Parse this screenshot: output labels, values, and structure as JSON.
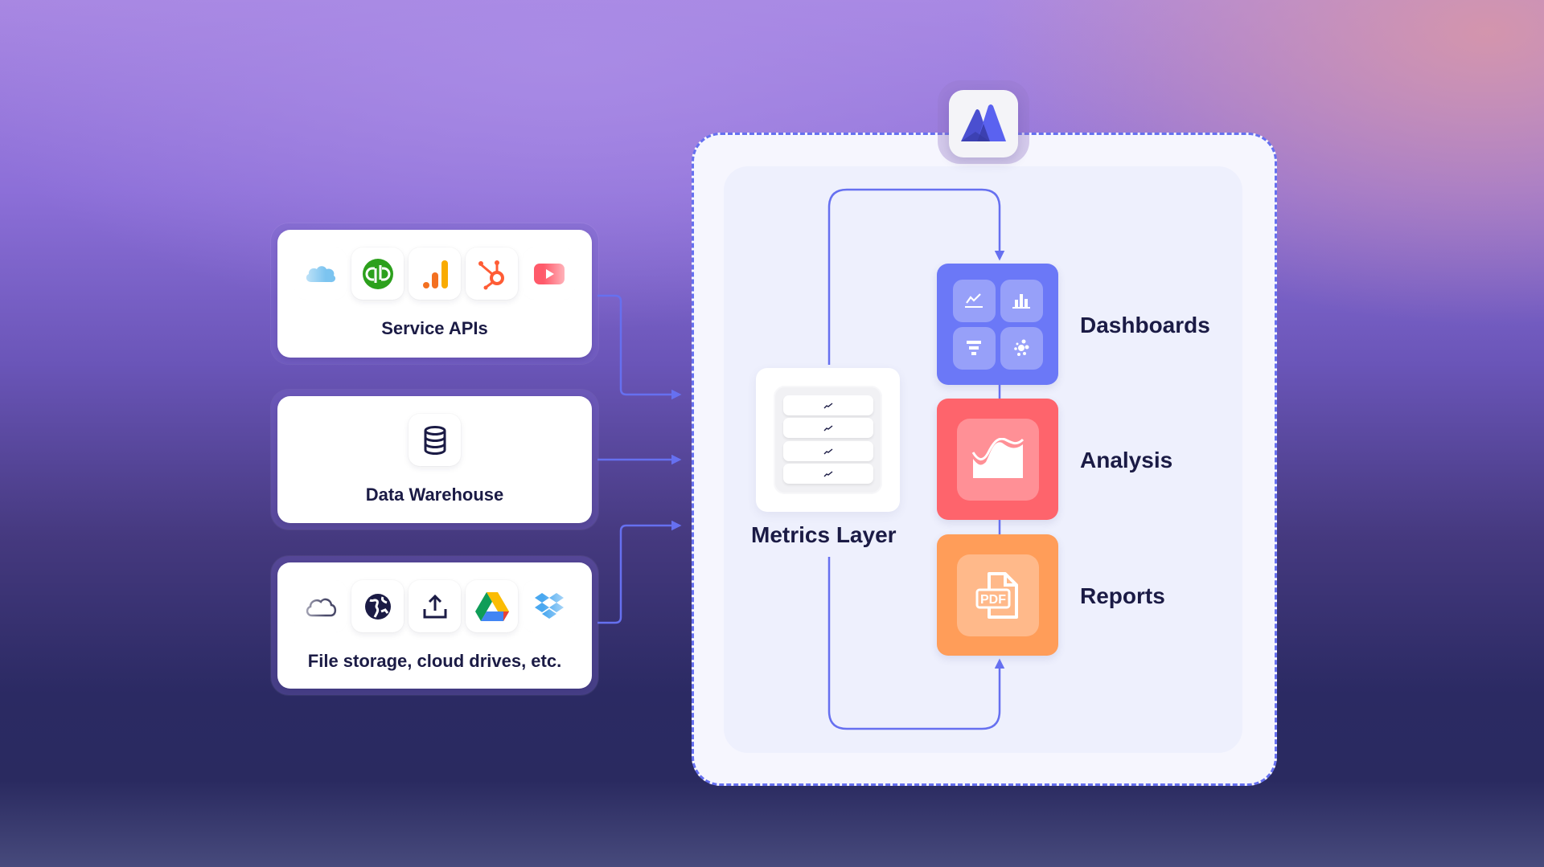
{
  "colors": {
    "accent_line": "#6670f0",
    "text_dark": "#1b1b45",
    "dashboards_fill": "#6b78f7",
    "analysis_fill": "#fe646c",
    "reports_fill": "#ff9d59",
    "logo_fill": "#4f55d8"
  },
  "sources": [
    {
      "title": "Service APIs",
      "icons": [
        "salesforce-icon",
        "quickbooks-icon",
        "google-analytics-icon",
        "hubspot-icon",
        "youtube-icon"
      ]
    },
    {
      "title": "Data Warehouse",
      "icons": [
        "database-icon"
      ]
    },
    {
      "title": "File storage, cloud drives, etc.",
      "icons": [
        "cloud-icon",
        "globe-icon",
        "upload-icon",
        "google-drive-icon",
        "dropbox-icon"
      ]
    }
  ],
  "platform": {
    "logo": "mountain-logo-icon",
    "metrics_layer": {
      "label": "Metrics Layer",
      "rows": 4,
      "row_icon": "trend-line-icon"
    },
    "outputs": [
      {
        "label": "Dashboards",
        "icons": [
          "line-chart-icon",
          "bar-chart-icon",
          "funnel-icon",
          "scatter-icon"
        ]
      },
      {
        "label": "Analysis",
        "icons": [
          "area-chart-icon"
        ]
      },
      {
        "label": "Reports",
        "icons": [
          "pdf-file-icon"
        ],
        "icon_text": "PDF"
      }
    ]
  }
}
